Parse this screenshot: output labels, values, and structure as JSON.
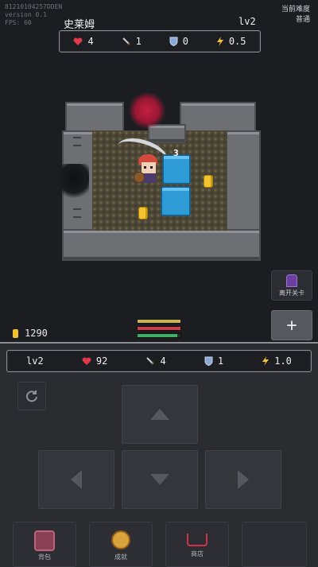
{
  "debug": {
    "line1": "81210104257DDEN",
    "line2": "version 0.1",
    "line3": "FPS: 60"
  },
  "difficulty": {
    "label": "当前难度",
    "value": "普通"
  },
  "enemy": {
    "name": "史莱姆",
    "level": "lv2",
    "hp": "4",
    "attack": "1",
    "defense": "0",
    "speed": "0.5"
  },
  "map": {
    "damage_number": "3"
  },
  "leave_level": {
    "label": "离开关卡"
  },
  "add_button": {
    "label": "+"
  },
  "gold": {
    "amount": "1290"
  },
  "player": {
    "level": "lv2",
    "hp": "92",
    "attack": "4",
    "defense": "1",
    "speed": "1.0",
    "hp_fraction": 1.0,
    "mp_fraction": 1.0,
    "xp_fraction": 0.92
  },
  "bottom_menu": {
    "backpack": "背包",
    "achievements": "成就",
    "shop": "商店"
  },
  "colors": {
    "hp": "#e0394a",
    "attack": "#b7bcc4",
    "defense": "#8aa7d6",
    "speed": "#f2c230",
    "gold": "#f2c230"
  }
}
